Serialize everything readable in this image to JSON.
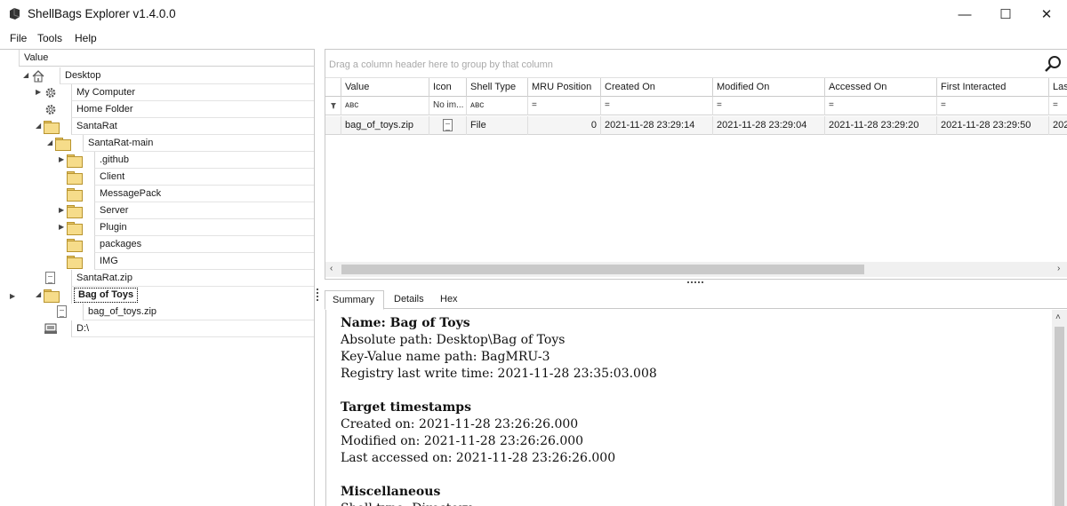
{
  "window": {
    "title": "ShellBags Explorer v1.4.0.0",
    "minimize": "—",
    "maximize": "☐",
    "close": "✕"
  },
  "menu": {
    "items": [
      "File",
      "Tools",
      "Help"
    ]
  },
  "tree": {
    "header": "Value",
    "rows": [
      {
        "label": "Desktop",
        "icon": "home-icon",
        "expander": "open"
      },
      {
        "label": "My Computer",
        "icon": "gear-icon",
        "expander": "closed"
      },
      {
        "label": "Home Folder",
        "icon": "gear-icon",
        "expander": "none"
      },
      {
        "label": "SantaRat",
        "icon": "folder-icon",
        "expander": "open"
      },
      {
        "label": "SantaRat-main",
        "icon": "folder-icon",
        "expander": "open"
      },
      {
        "label": ".github",
        "icon": "folder-icon",
        "expander": "closed"
      },
      {
        "label": "Client",
        "icon": "folder-icon",
        "expander": "none"
      },
      {
        "label": "MessagePack",
        "icon": "folder-icon",
        "expander": "none"
      },
      {
        "label": "Server",
        "icon": "folder-icon",
        "expander": "closed"
      },
      {
        "label": "Plugin",
        "icon": "folder-icon",
        "expander": "closed"
      },
      {
        "label": "packages",
        "icon": "folder-icon",
        "expander": "none"
      },
      {
        "label": "IMG",
        "icon": "folder-icon",
        "expander": "none"
      },
      {
        "label": "SantaRat.zip",
        "icon": "file-icon",
        "expander": "none"
      },
      {
        "label": "Bag of Toys",
        "icon": "folder-icon",
        "expander": "open",
        "selected": true
      },
      {
        "label": "bag_of_toys.zip",
        "icon": "file-icon",
        "expander": "none"
      },
      {
        "label": "D:\\",
        "icon": "drive-icon",
        "expander": "none"
      }
    ]
  },
  "grid": {
    "group_hint": "Drag a column header here to group by that column",
    "columns": [
      "Value",
      "Icon",
      "Shell Type",
      "MRU Position",
      "Created On",
      "Modified On",
      "Accessed On",
      "First Interacted",
      "Las"
    ],
    "filter_row": [
      "ᴀʙc",
      "No im...",
      "ᴀʙc",
      "=",
      "=",
      "=",
      "=",
      "=",
      "="
    ],
    "rows": [
      [
        "bag_of_toys.zip",
        "",
        "File",
        "0",
        "2021-11-28 23:29:14",
        "2021-11-28 23:29:04",
        "2021-11-28 23:29:20",
        "2021-11-28 23:29:50",
        "202"
      ]
    ]
  },
  "tabs": [
    "Summary",
    "Details",
    "Hex"
  ],
  "summary": {
    "name_line": "Name: Bag of Toys",
    "absolute_path": "Absolute path: Desktop\\Bag of Toys",
    "key_value_path": "Key-Value name path: BagMRU-3",
    "registry_write": "Registry last write time: 2021-11-28 23:35:03.008",
    "target_heading": "Target timestamps",
    "created": "Created on: 2021-11-28 23:26:26.000",
    "modified": "Modified on: 2021-11-28 23:26:26.000",
    "accessed": "Last accessed on: 2021-11-28 23:26:26.000",
    "misc_heading": "Miscellaneous",
    "shell_type": "Shell type: Directory"
  }
}
